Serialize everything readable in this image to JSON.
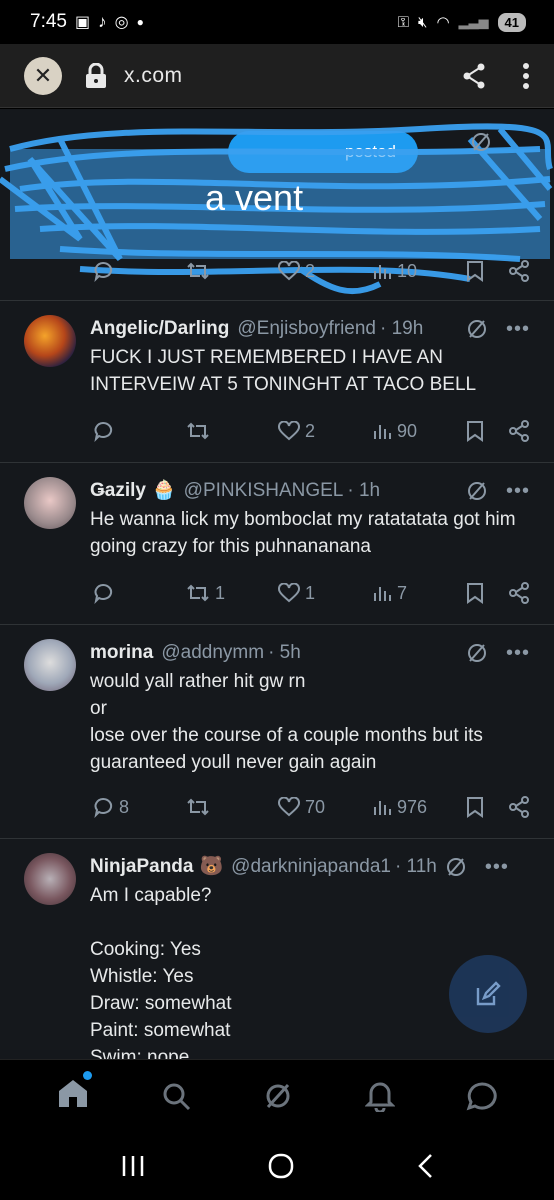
{
  "status_bar": {
    "time": "7:45",
    "battery": "41",
    "network": "5G"
  },
  "url_bar": {
    "url": "x.com"
  },
  "top_partial": {
    "overlay_text": "a vent",
    "pill_text": "posted",
    "likes": "2",
    "views": "10"
  },
  "tweets": [
    {
      "name": "Angelic/Darling",
      "handle": "@Enjisboyfriend",
      "time": "· 19h",
      "text": "FUCK I JUST REMEMBERED I HAVE AN INTERVEIW AT 5 TONINGHT AT TACO BELL",
      "replies": "",
      "retweets": "",
      "likes": "2",
      "views": "90"
    },
    {
      "name": "Ǥazily",
      "name_emoji": "🧁",
      "handle": "@PINKISHANGEL",
      "time": "· 1h",
      "text": "He wanna lick my bomboclat my ratatatata got him going crazy for this puhnananana",
      "replies": "",
      "retweets": "1",
      "likes": "1",
      "views": "7"
    },
    {
      "name": "morina",
      "handle": "@addnymm",
      "time": "· 5h",
      "text": "would yall rather hit gw rn\nor\nlose over the course of a couple months but its guaranteed youll never gain again",
      "replies": "8",
      "retweets": "",
      "likes": "70",
      "views": "976"
    },
    {
      "name": "NinjaPanda",
      "name_emoji": "🐻",
      "handle": "@darkninjapanda1",
      "time": "· 11h",
      "text": "Am I capable?\n\nCooking: Yes\nWhistle: Yes\nDraw: somewhat\nPaint: somewhat\nSwim: nope\nEnglish: Yes\nDance: No no no"
    }
  ],
  "icons": {
    "reply": "reply-icon",
    "retweet": "retweet-icon",
    "like": "heart-icon",
    "views": "views-icon",
    "bookmark": "bookmark-icon",
    "share": "share-icon",
    "grok": "grok-icon",
    "compose": "compose-icon"
  },
  "colors": {
    "background": "#15181c",
    "accent": "#1d9bf0",
    "muted": "#8b98a5",
    "scribble": "#3aa0f0"
  }
}
